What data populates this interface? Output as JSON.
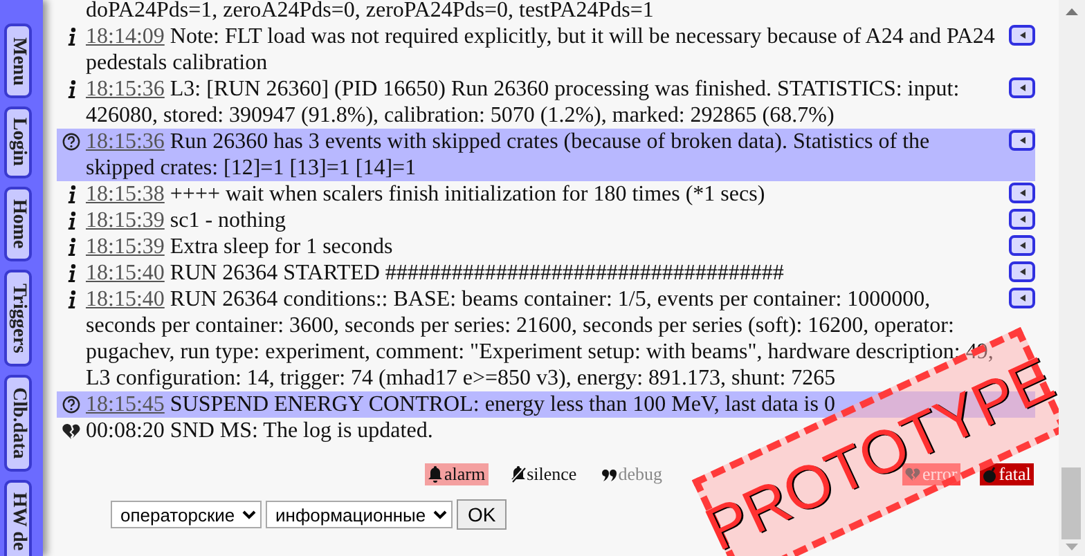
{
  "sidebar": {
    "tabs": [
      {
        "label": "Menu"
      },
      {
        "label": "Login"
      },
      {
        "label": "Home"
      },
      {
        "label": "Triggers"
      },
      {
        "label": "Clb.data"
      },
      {
        "label": "HW de"
      }
    ]
  },
  "log": [
    {
      "kind": "info",
      "text": "doPA24Pds=1, zeroA24Pds=0, zeroPA24Pds=0, testPA24Pds=1",
      "expand_button": false
    },
    {
      "kind": "info",
      "time": "18:14:09",
      "text": "Note: FLT load was not required explicitly, but it will be necessary because of A24 and PA24 pedestals calibration",
      "expand_button": true
    },
    {
      "kind": "info",
      "time": "18:15:36",
      "text": "L3: [RUN 26360] (PID 16650) Run 26360 processing was finished. STATISTICS: input: 426080, stored: 390947 (91.8%), calibration: 5070 (1.2%), marked: 292865 (68.7%)",
      "expand_button": true
    },
    {
      "kind": "question",
      "time": "18:15:36",
      "text": "Run 26360 has 3 events with skipped crates (because of broken data). Statistics of the skipped crates: [12]=1 [13]=1 [14]=1",
      "expand_button": true
    },
    {
      "kind": "info",
      "time": "18:15:38",
      "text": "++++ wait when scalers finish initialization for 180 times (*1 secs)",
      "expand_button": true
    },
    {
      "kind": "info",
      "time": "18:15:39",
      "text": "sc1 - nothing",
      "expand_button": true
    },
    {
      "kind": "info",
      "time": "18:15:39",
      "text": "Extra sleep for 1 seconds",
      "expand_button": true
    },
    {
      "kind": "info",
      "time": "18:15:40",
      "text": "RUN 26364 STARTED ####################################",
      "expand_button": true
    },
    {
      "kind": "info",
      "time": "18:15:40",
      "text": "RUN 26364 conditions:: BASE: beams container: 1/5, events per container: 1000000, seconds per container: 3600, seconds per series: 21600, seconds per series (soft): 16200, operator: pugachev, run type: experiment, comment: \"Experiment setup: with beams\", hardware description: 49, L3 configuration: 14, trigger: 74 (mhad17 e>=850 v3), energy: 891.173, shunt: 7265",
      "expand_button": true
    },
    {
      "kind": "question",
      "time": "18:15:45",
      "text": "SUSPEND ENERGY CONTROL: energy less than 100 MeV, last data is 0",
      "expand_button": false
    },
    {
      "kind": "broken",
      "time_plain": "00:08:20",
      "text": "SND MS: The log is updated.",
      "expand_button": false
    }
  ],
  "levels": [
    {
      "kind": "alarm",
      "label": "alarm"
    },
    {
      "kind": "silence",
      "label": "silence"
    },
    {
      "kind": "debug",
      "label": "debug"
    },
    {
      "kind": "error",
      "label": "error"
    },
    {
      "kind": "fatal",
      "label": "fatal"
    }
  ],
  "filters": {
    "group": "операторские",
    "type": "информационные",
    "ok": "OK"
  },
  "stamp": "PROTOTYPE"
}
